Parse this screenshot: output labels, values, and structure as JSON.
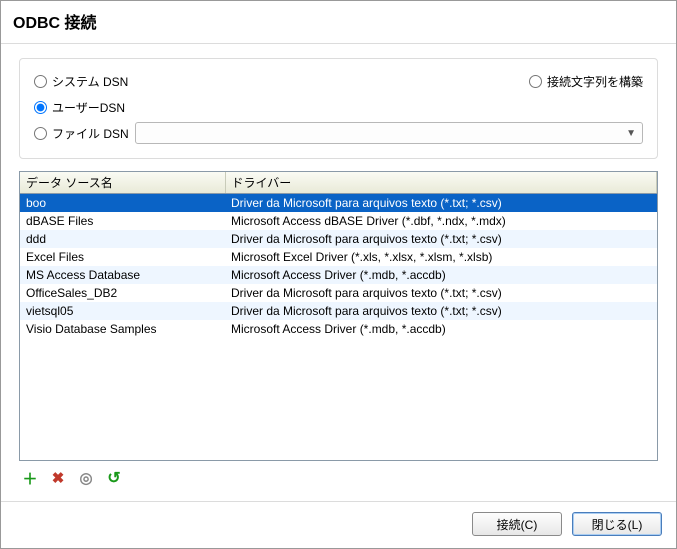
{
  "title": "ODBC 接続",
  "dsn": {
    "system": "システム DSN",
    "user": "ユーザーDSN",
    "file": "ファイル DSN",
    "build_conn": "接続文字列を構築",
    "selected": "user",
    "file_value": ""
  },
  "table": {
    "headers": {
      "name": "データ ソース名",
      "driver": "ドライバー"
    },
    "rows": [
      {
        "name": "boo",
        "driver": "Driver da Microsoft para arquivos texto (*.txt; *.csv)",
        "selected": true
      },
      {
        "name": "dBASE Files",
        "driver": "Microsoft Access dBASE Driver (*.dbf, *.ndx, *.mdx)"
      },
      {
        "name": "ddd",
        "driver": "Driver da Microsoft para arquivos texto (*.txt; *.csv)",
        "alt": true
      },
      {
        "name": "Excel Files",
        "driver": "Microsoft Excel Driver (*.xls, *.xlsx, *.xlsm, *.xlsb)"
      },
      {
        "name": "MS Access Database",
        "driver": "Microsoft Access Driver (*.mdb, *.accdb)",
        "alt": true
      },
      {
        "name": "OfficeSales_DB2",
        "driver": "Driver da Microsoft para arquivos texto (*.txt; *.csv)"
      },
      {
        "name": "vietsql05",
        "driver": "Driver da Microsoft para arquivos texto (*.txt; *.csv)",
        "alt": true
      },
      {
        "name": "Visio Database Samples",
        "driver": "Microsoft Access Driver (*.mdb, *.accdb)"
      }
    ]
  },
  "toolbar": {
    "add": "＋",
    "delete": "✖",
    "edit": "◎",
    "refresh": "↺"
  },
  "footer": {
    "connect": "接続(C)",
    "close": "閉じる(L)"
  }
}
